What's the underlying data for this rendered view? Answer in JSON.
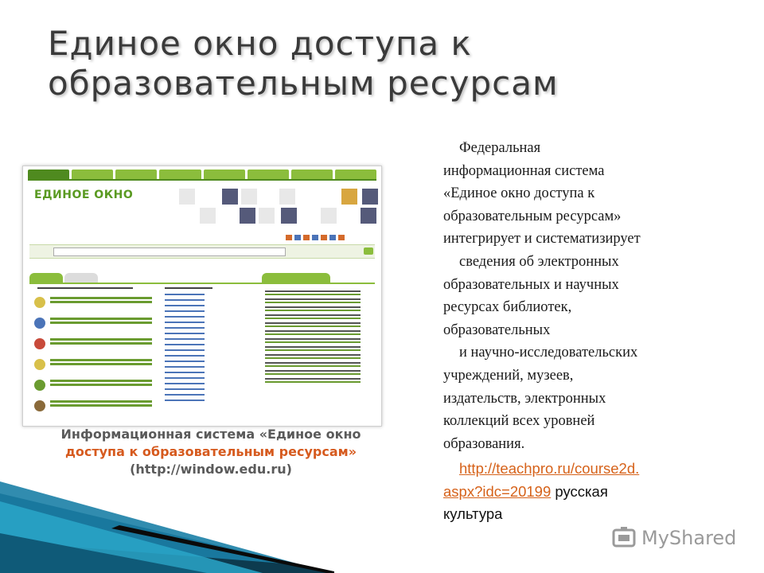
{
  "slide": {
    "title_lines": [
      "Единое окно доступа к",
      "образовательным ресурсам"
    ],
    "body_lines": [
      "Федеральная",
      "информационная система",
      "«Единое окно доступа к",
      "образовательным ресурсам»",
      "интегрирует и систематизирует",
      "сведения об электронных",
      "образовательных и научных",
      "ресурсах библиотек,",
      "образовательных",
      "и научно-исследовательских",
      "учреждений, музеев,",
      "издательств, электронных",
      "коллекций всех уровней",
      "образования."
    ],
    "link_line1": "http://teachpro.ru/course2d.",
    "link_line2": "aspx?idc=20199",
    "link_after": " русская",
    "link_last": "культура",
    "caption_line1": "Информационная система «Единое окно",
    "caption_line2": "доступа к образовательным ресурсам»",
    "caption_line3": "(http://window.edu.ru)"
  },
  "screenshot": {
    "logo": "ЕДИНОЕ ОКНО"
  },
  "watermark": {
    "text": "MyShared",
    "icon": "myshared-logo-icon"
  },
  "colors": {
    "title": "#3a3a3a",
    "link": "#d6621a",
    "site_green": "#8bbd3c",
    "ribbon_dark": "#0d3b4f",
    "ribbon_teal": "#2aa6c8"
  }
}
